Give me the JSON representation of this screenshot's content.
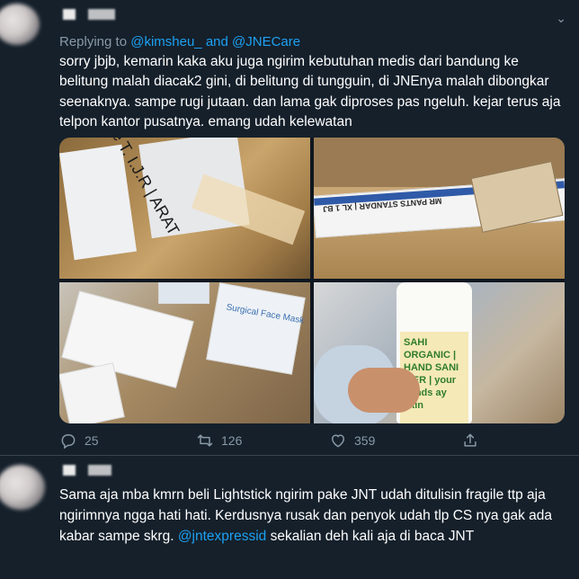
{
  "tweet1": {
    "replying_prefix": "Replying to",
    "mention_1": "@kimsheu_",
    "and_word": "and",
    "mention_2": "@JNECare",
    "text": "sorry jbjb, kemarin kaka aku juga ngirim kebutuhan medis dari bandung ke belitung malah diacak2 gini, di belitung di tungguin, di JNEnya malah dibongkar seenaknya. sampe rugi jutaan. dan lama gak diproses pas ngeluh. kejar terus aja telpon kantor pusatnya. emang udah kelewatan",
    "photos": [
      {
        "text": "e T. I.J.R | ARAT"
      },
      {
        "text": "MR PANTS STANDAR | XL 1 BJ"
      },
      {
        "text": "Surgical Face Mask"
      },
      {
        "text": "SAHI ORGANIC | HAND SANI IZER | your hands ay skin"
      }
    ],
    "reply_count": "25",
    "retweet_count": "126",
    "like_count": "359"
  },
  "tweet2": {
    "text_before": "Sama aja mba kmrn beli Lightstick ngirim pake JNT udah ditulisin fragile ttp aja ngirimnya ngga hati hati. Kerdusnya rusak dan penyok udah tlp CS nya gak ada kabar sampe skrg.",
    "mention": "@jntexpressid",
    "text_after": "sekalian deh kali aja di baca JNT"
  },
  "colors": {
    "background": "#15202b",
    "link": "#1da1f2",
    "muted": "#8899a6",
    "text": "#ffffff"
  },
  "icons": [
    "chevron-down-icon",
    "reply-icon",
    "retweet-icon",
    "like-icon",
    "share-icon"
  ]
}
